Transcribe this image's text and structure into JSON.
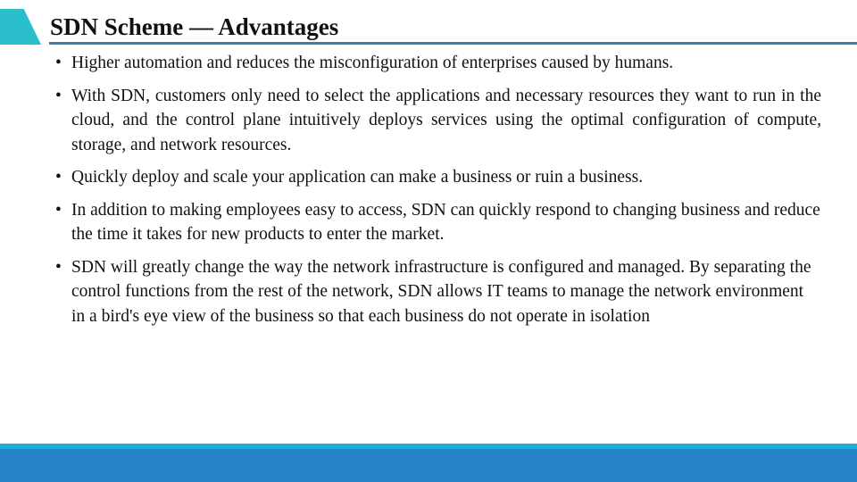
{
  "slide": {
    "title": "SDN Scheme — Advantages",
    "bullet_glyph": "•",
    "bullets": [
      {
        "text": "Higher automation and reduces the misconfiguration of enterprises caused by humans."
      },
      {
        "text": "With SDN, customers only need to select the applications and necessary resources they want to run in the cloud, and the control plane intuitively deploys services using the optimal configuration of compute, storage, and network resources."
      },
      {
        "text": "Quickly deploy and scale your application can make a business or ruin a business."
      },
      {
        "text": "In addition to making employees easy to access, SDN can quickly respond to changing business and reduce the time it takes for new products to enter the market."
      },
      {
        "text": "SDN will greatly change the way the network infrastructure is configured and managed. By separating the control functions from the rest of the network, SDN allows IT teams to manage the network environment in a bird's eye view of the business so that each business do not operate in isolation"
      }
    ]
  },
  "colors": {
    "accent_teal": "#2bbfcc",
    "title_rule": "#3d7ea8",
    "footer_stripe": "#20a9dd",
    "footer_band": "#2782c5"
  }
}
